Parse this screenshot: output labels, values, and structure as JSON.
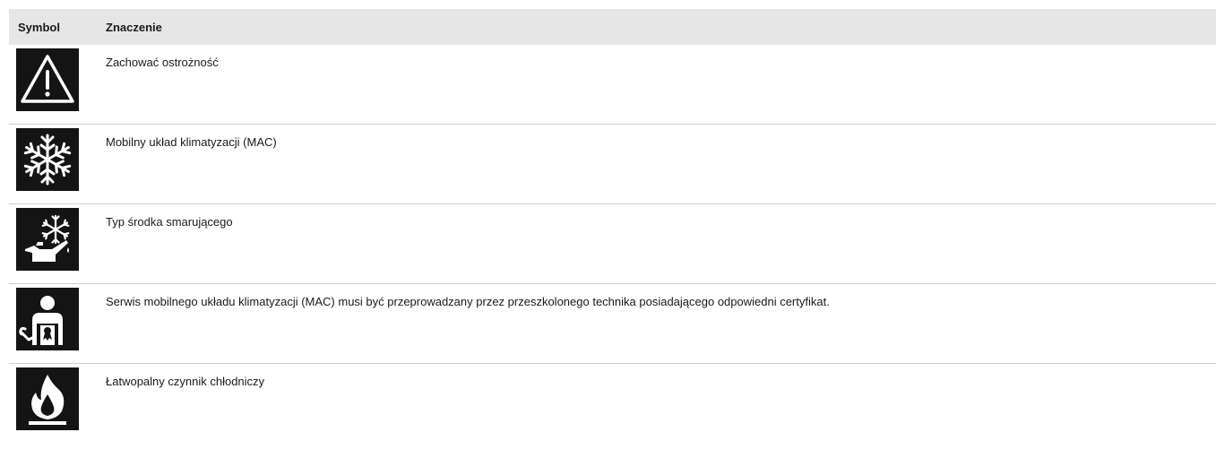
{
  "table": {
    "headers": {
      "symbol": "Symbol",
      "meaning": "Znaczenie"
    },
    "rows": [
      {
        "icon": "warning-triangle-icon",
        "text": "Zachować ostrożność"
      },
      {
        "icon": "snowflake-icon",
        "text": "Mobilny układ klimatyzacji (MAC)"
      },
      {
        "icon": "oil-can-snowflake-icon",
        "text": "Typ środka smarującego"
      },
      {
        "icon": "certified-technician-icon",
        "text": "Serwis mobilnego układu klimatyzacji (MAC) musi być przeprowadzany przez przeszkolonego technika posiadającego odpowiedni certyfikat."
      },
      {
        "icon": "flame-icon",
        "text": "Łatwopalny czynnik chłodniczy"
      }
    ]
  },
  "colors": {
    "header_bg": "#e6e6e6",
    "icon_bg": "#141414",
    "icon_fg": "#ffffff",
    "row_border": "#cfcfcf"
  }
}
